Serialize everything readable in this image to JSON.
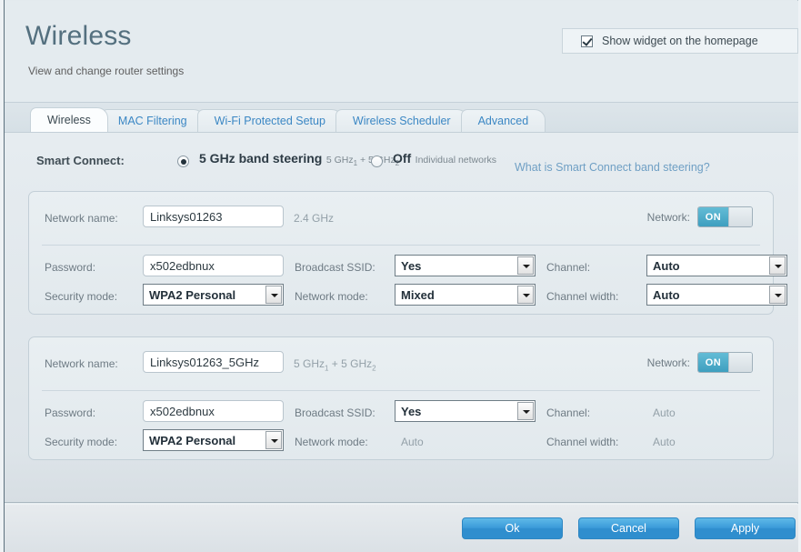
{
  "header": {
    "title": "Wireless",
    "subtitle": "View and change router settings",
    "widget_checkbox": {
      "label": "Show widget on the homepage",
      "checked": true,
      "icon": "checkmark-icon"
    }
  },
  "tabs": [
    {
      "label": "Wireless",
      "active": true
    },
    {
      "label": "MAC Filtering",
      "active": false
    },
    {
      "label": "Wi-Fi Protected Setup",
      "active": false
    },
    {
      "label": "Wireless Scheduler",
      "active": false
    },
    {
      "label": "Advanced",
      "active": false
    }
  ],
  "smart_connect": {
    "label": "Smart Connect:",
    "options": [
      {
        "title": "5 GHz band steering",
        "sub_prefix": "5 GHz",
        "sub_sub1": "1",
        "sub_mid": " + 5 GHz",
        "sub_sub2": "2",
        "selected": true
      },
      {
        "title": "Off",
        "sub": "Individual networks",
        "selected": false
      }
    ],
    "help_link": "What is Smart Connect band steering?"
  },
  "networks": [
    {
      "name_label": "Network name:",
      "name_value": "Linksys01263",
      "band_text": "2.4 GHz",
      "band_has_subscripts": false,
      "network_label": "Network:",
      "network_toggle": "ON",
      "password_label": "Password:",
      "password_value": "x502edbnux",
      "security_label": "Security mode:",
      "security_value": "WPA2 Personal",
      "broadcast_label": "Broadcast SSID:",
      "broadcast_value": "Yes",
      "netmode_label": "Network mode:",
      "netmode_value": "Mixed",
      "netmode_is_select": true,
      "channel_label": "Channel:",
      "channel_value": "Auto",
      "channel_is_select": true,
      "width_label": "Channel width:",
      "width_value": "Auto",
      "width_is_select": true
    },
    {
      "name_label": "Network name:",
      "name_value": "Linksys01263_5GHz",
      "band_text": "5 GHz",
      "band_has_subscripts": true,
      "band_sub1": "1",
      "band_mid": " + 5 GHz",
      "band_sub2": "2",
      "network_label": "Network:",
      "network_toggle": "ON",
      "password_label": "Password:",
      "password_value": "x502edbnux",
      "security_label": "Security mode:",
      "security_value": "WPA2 Personal",
      "broadcast_label": "Broadcast SSID:",
      "broadcast_value": "Yes",
      "netmode_label": "Network mode:",
      "netmode_value": "Auto",
      "netmode_is_select": false,
      "channel_label": "Channel:",
      "channel_value": "Auto",
      "channel_is_select": false,
      "width_label": "Channel width:",
      "width_value": "Auto",
      "width_is_select": false
    }
  ],
  "footer": {
    "ok": "Ok",
    "cancel": "Cancel",
    "apply": "Apply"
  },
  "colors": {
    "accent_blue": "#3a9ad9",
    "link_blue": "#6f9fc4",
    "toggle_on": "#3e9fbf",
    "title_gray": "#54707f"
  }
}
